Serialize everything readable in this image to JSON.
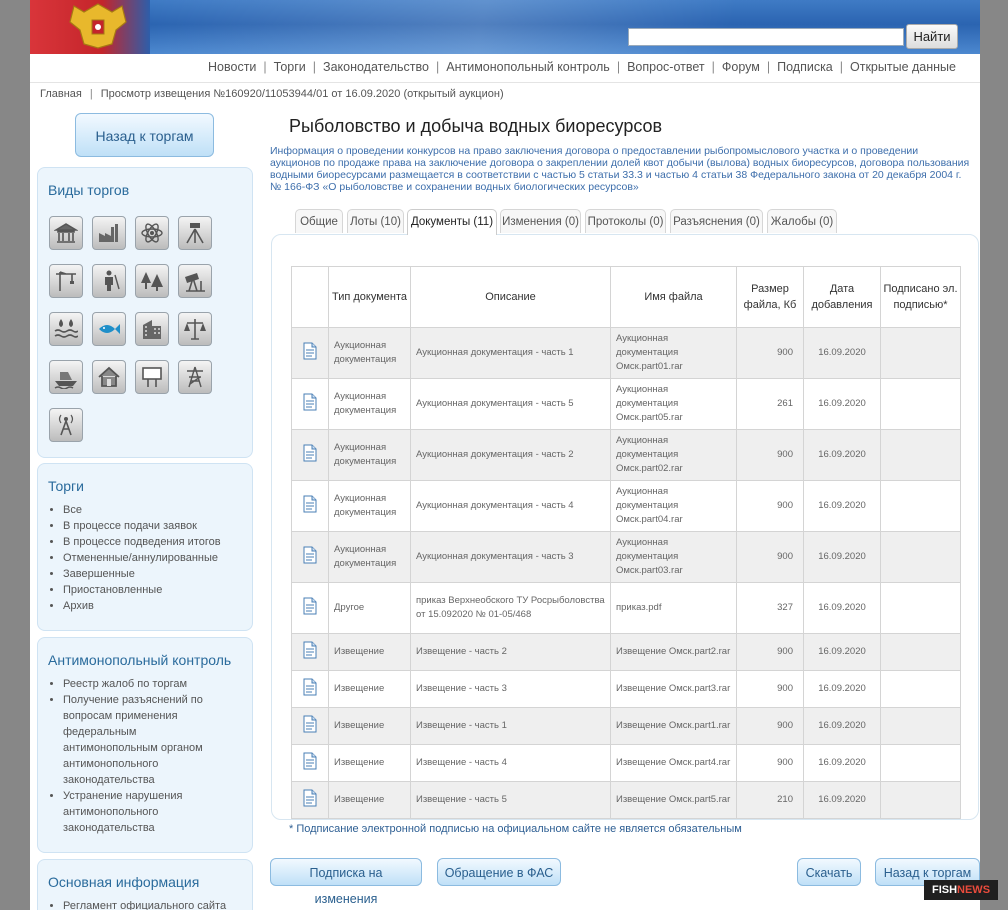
{
  "header": {
    "search_button": "Найти"
  },
  "topnav": [
    "Новости",
    "Торги",
    "Законодательство",
    "Антимонопольный контроль",
    "Вопрос-ответ",
    "Форум",
    "Подписка",
    "Открытые данные"
  ],
  "breadcrumb": {
    "home": "Главная",
    "current": "Просмотр извещения №160920/11053944/01 от 16.09.2020 (открытый аукцион)"
  },
  "sidebar": {
    "back_button": "Назад к торгам",
    "types_title": "Виды торгов",
    "type_icons": [
      "bank-icon",
      "factory-icon",
      "atom-icon",
      "theodolite-icon",
      "crane-icon",
      "hunter-icon",
      "forest-icon",
      "oil-pump-icon",
      "water-icon",
      "fish-icon",
      "building-icon",
      "scales-icon",
      "boat-icon",
      "house-icon",
      "billboard-icon",
      "power-line-icon",
      "radio-tower-icon"
    ],
    "trade_title": "Торги",
    "trade_items": [
      "Все",
      "В процессе подачи заявок",
      "В процессе подведения итогов",
      "Отмененные/аннулированные",
      "Завершенные",
      "Приостановленные",
      "Архив"
    ],
    "anti_title": "Антимонопольный контроль",
    "anti_items": [
      "Реестр жалоб по торгам",
      "Получение разъяснений по вопросам применения федеральным антимонопольным органом антимонопольного законодательства",
      "Устранение нарушения антимонопольного законодательства"
    ],
    "info_title": "Основная информация",
    "info_items": [
      "Регламент официального сайта"
    ]
  },
  "main": {
    "title": "Рыболовство и добыча водных биоресурсов",
    "description": "Информация о проведении конкурсов на право заключения договора о предоставлении рыбопромыслового участка и о проведении аукционов по продаже права на заключение договора о закреплении долей квот добычи (вылова) водных биоресурсов, договора пользования водными биоресурсами размещается в соответствии с частью 5 статьи 33.3 и частью 4 статьи 38 Федерального закона от 20 декабря 2004 г. № 166-ФЗ «О рыболовстве и сохранении водных биологических ресурсов»",
    "tabs": [
      "Общие",
      "Лоты (10)",
      "Документы (11)",
      "Изменения (0)",
      "Протоколы (0)",
      "Разъяснения (0)",
      "Жалобы (0)"
    ],
    "active_tab": "Документы (11)",
    "table": {
      "headers": [
        "",
        "Тип документа",
        "Описание",
        "Имя файла",
        "Размер файла, Кб",
        "Дата добавления",
        "Подписано эл. подписью*"
      ],
      "rows": [
        {
          "type": "Аукционная документация",
          "desc": "Аукционная документация - часть 1",
          "file": "Аукционная документация Омск.part01.rar",
          "size": "900",
          "date": "16.09.2020",
          "signed": ""
        },
        {
          "type": "Аукционная документация",
          "desc": "Аукционная документация - часть 5",
          "file": "Аукционная документация Омск.part05.rar",
          "size": "261",
          "date": "16.09.2020",
          "signed": ""
        },
        {
          "type": "Аукционная документация",
          "desc": "Аукционная документация - часть 2",
          "file": "Аукционная документация Омск.part02.rar",
          "size": "900",
          "date": "16.09.2020",
          "signed": ""
        },
        {
          "type": "Аукционная документация",
          "desc": "Аукционная документация - часть 4",
          "file": "Аукционная документация Омск.part04.rar",
          "size": "900",
          "date": "16.09.2020",
          "signed": ""
        },
        {
          "type": "Аукционная документация",
          "desc": "Аукционная документация - часть 3",
          "file": "Аукционная документация Омск.part03.rar",
          "size": "900",
          "date": "16.09.2020",
          "signed": ""
        },
        {
          "type": "Другое",
          "desc": "приказ Верхнеобского ТУ Росрыболовства от 15.092020 № 01-05/468",
          "file": "приказ.pdf",
          "size": "327",
          "date": "16.09.2020",
          "signed": ""
        },
        {
          "type": "Извещение",
          "desc": "Извещение - часть 2",
          "file": "Извещение Омск.part2.rar",
          "size": "900",
          "date": "16.09.2020",
          "signed": ""
        },
        {
          "type": "Извещение",
          "desc": "Извещение - часть 3",
          "file": "Извещение Омск.part3.rar",
          "size": "900",
          "date": "16.09.2020",
          "signed": ""
        },
        {
          "type": "Извещение",
          "desc": "Извещение - часть 1",
          "file": "Извещение Омск.part1.rar",
          "size": "900",
          "date": "16.09.2020",
          "signed": ""
        },
        {
          "type": "Извещение",
          "desc": "Извещение - часть 4",
          "file": "Извещение Омск.part4.rar",
          "size": "900",
          "date": "16.09.2020",
          "signed": ""
        },
        {
          "type": "Извещение",
          "desc": "Извещение - часть 5",
          "file": "Извещение Омск.part5.rar",
          "size": "210",
          "date": "16.09.2020",
          "signed": ""
        }
      ]
    },
    "footnote": "* Подписание электронной подписью на официальном сайте не является обязательным",
    "buttons": {
      "subscribe": "Подписка на изменения",
      "fas": "Обращение в ФАС",
      "download": "Скачать",
      "back": "Назад к торгам"
    }
  },
  "watermark": {
    "part1": "FISH",
    "part2": "NEWS"
  }
}
